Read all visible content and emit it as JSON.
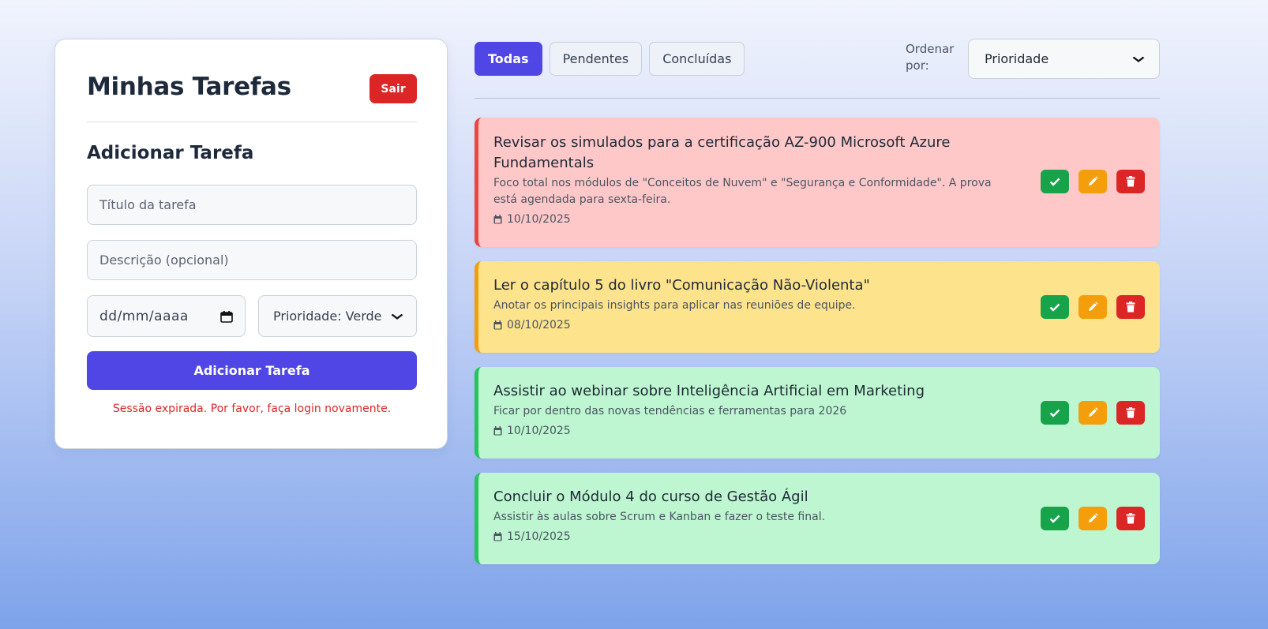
{
  "sidebar": {
    "title": "Minhas Tarefas",
    "logout_label": "Sair",
    "section_title": "Adicionar Tarefa",
    "title_placeholder": "Título da tarefa",
    "description_placeholder": "Descrição (opcional)",
    "date_placeholder": "dd/mm/aaaa",
    "priority_selected": "Prioridade: Verde",
    "add_button_label": "Adicionar Tarefa",
    "error_message": "Sessão expirada. Por favor, faça login novamente."
  },
  "filters": {
    "tabs": [
      {
        "label": "Todas",
        "active": true
      },
      {
        "label": "Pendentes",
        "active": false
      },
      {
        "label": "Concluídas",
        "active": false
      }
    ],
    "sort_label": "Ordenar por:",
    "sort_selected": "Prioridade"
  },
  "tasks": [
    {
      "title": "Revisar os simulados para a certificação AZ-900 Microsoft Azure Fundamentals",
      "description": "Foco total nos módulos de \"Conceitos de Nuvem\" e \"Segurança e Conformidade\". A prova está agendada para sexta-feira.",
      "date": "10/10/2025",
      "priority_color": "red"
    },
    {
      "title": "Ler o capítulo 5 do livro \"Comunicação Não-Violenta\"",
      "description": "Anotar os principais insights para aplicar nas reuniões de equipe.",
      "date": "08/10/2025",
      "priority_color": "yellow"
    },
    {
      "title": "Assistir ao webinar sobre Inteligência Artificial em Marketing",
      "description": "Ficar por dentro das novas tendências e ferramentas para 2026",
      "date": "10/10/2025",
      "priority_color": "green"
    },
    {
      "title": "Concluir o Módulo 4 do curso de Gestão Ágil",
      "description": "Assistir às aulas sobre Scrum e Kanban e fazer o teste final.",
      "date": "15/10/2025",
      "priority_color": "green"
    }
  ],
  "icons": {
    "complete": "check-icon",
    "edit": "pencil-icon",
    "delete": "trash-icon",
    "date": "calendar-icon"
  },
  "colors": {
    "primary": "#4f46e5",
    "danger": "#dc2626",
    "success": "#16a34a",
    "warning": "#f59e0b",
    "priority_red_bg": "#fec8c8",
    "priority_yellow_bg": "#fce38c",
    "priority_green_bg": "#bdf6d0"
  }
}
